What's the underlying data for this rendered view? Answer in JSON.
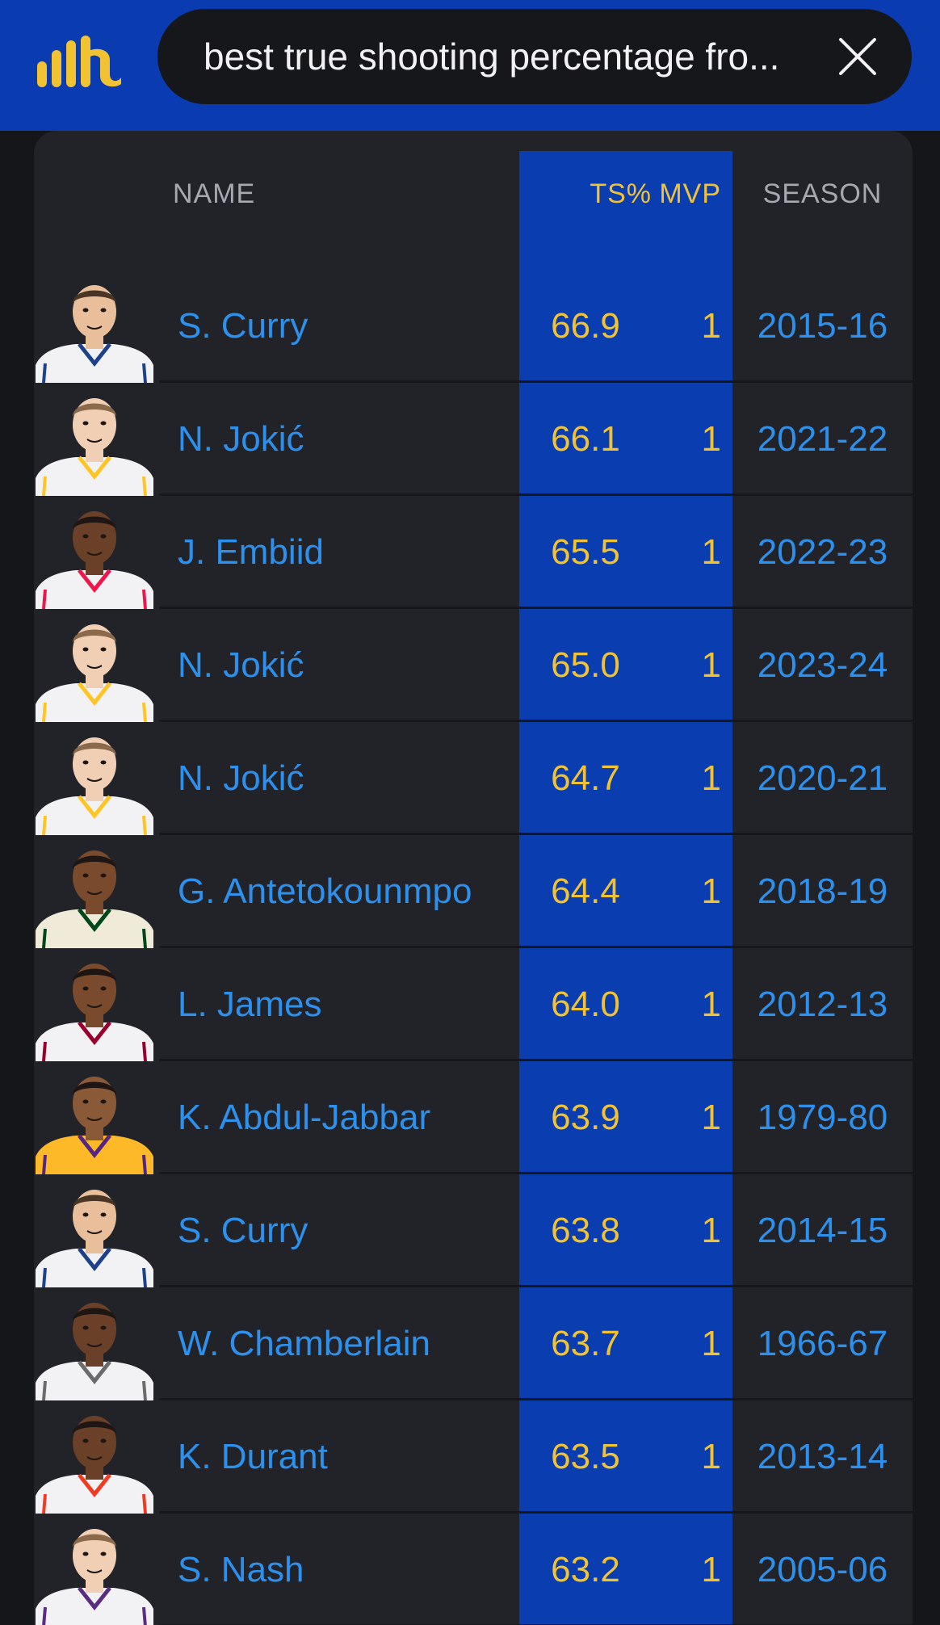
{
  "search": {
    "query": "best true shooting percentage fro..."
  },
  "table": {
    "headers": {
      "name": "NAME",
      "ts": "TS%",
      "mvp": "MVP",
      "season": "SEASON"
    },
    "rows": [
      {
        "name": "S. Curry",
        "ts": "66.9",
        "mvp": "1",
        "season": "2015-16",
        "jersey": "#f2f2f4",
        "trim": "#1d428a",
        "skin": "#e8bf9a",
        "hair": "#4a3424"
      },
      {
        "name": "N. Jokić",
        "ts": "66.1",
        "mvp": "1",
        "season": "2021-22",
        "jersey": "#f2f2f4",
        "trim": "#fec524",
        "skin": "#f0cfb4",
        "hair": "#8a6a4a"
      },
      {
        "name": "J. Embiid",
        "ts": "65.5",
        "mvp": "1",
        "season": "2022-23",
        "jersey": "#f2f2f4",
        "trim": "#ed174c",
        "skin": "#6b4028",
        "hair": "#1e1612"
      },
      {
        "name": "N. Jokić",
        "ts": "65.0",
        "mvp": "1",
        "season": "2023-24",
        "jersey": "#f2f2f4",
        "trim": "#fec524",
        "skin": "#f0cfb4",
        "hair": "#8a6a4a"
      },
      {
        "name": "N. Jokić",
        "ts": "64.7",
        "mvp": "1",
        "season": "2020-21",
        "jersey": "#f2f2f4",
        "trim": "#fec524",
        "skin": "#f0cfb4",
        "hair": "#8a6a4a"
      },
      {
        "name": "G. Antetokounmpo",
        "ts": "64.4",
        "mvp": "1",
        "season": "2018-19",
        "jersey": "#f0ebd8",
        "trim": "#00471b",
        "skin": "#7a4a2c",
        "hair": "#1e1612"
      },
      {
        "name": "L. James",
        "ts": "64.0",
        "mvp": "1",
        "season": "2012-13",
        "jersey": "#f2f2f4",
        "trim": "#98002e",
        "skin": "#7a4a2c",
        "hair": "#1e1612"
      },
      {
        "name": "K. Abdul-Jabbar",
        "ts": "63.9",
        "mvp": "1",
        "season": "1979-80",
        "jersey": "#fdb927",
        "trim": "#552583",
        "skin": "#8a5a38",
        "hair": "#1e1612"
      },
      {
        "name": "S. Curry",
        "ts": "63.8",
        "mvp": "1",
        "season": "2014-15",
        "jersey": "#f2f2f4",
        "trim": "#1d428a",
        "skin": "#e8bf9a",
        "hair": "#4a3424"
      },
      {
        "name": "W. Chamberlain",
        "ts": "63.7",
        "mvp": "1",
        "season": "1966-67",
        "jersey": "#f2f2f4",
        "trim": "#6b6b6b",
        "skin": "#6b4028",
        "hair": "#1e1612"
      },
      {
        "name": "K. Durant",
        "ts": "63.5",
        "mvp": "1",
        "season": "2013-14",
        "jersey": "#f2f2f4",
        "trim": "#ef3b24",
        "skin": "#6b4028",
        "hair": "#1e1612"
      },
      {
        "name": "S. Nash",
        "ts": "63.2",
        "mvp": "1",
        "season": "2005-06",
        "jersey": "#f2f2f4",
        "trim": "#5a2d81",
        "skin": "#f0cfb4",
        "hair": "#8a6a4a"
      }
    ]
  }
}
